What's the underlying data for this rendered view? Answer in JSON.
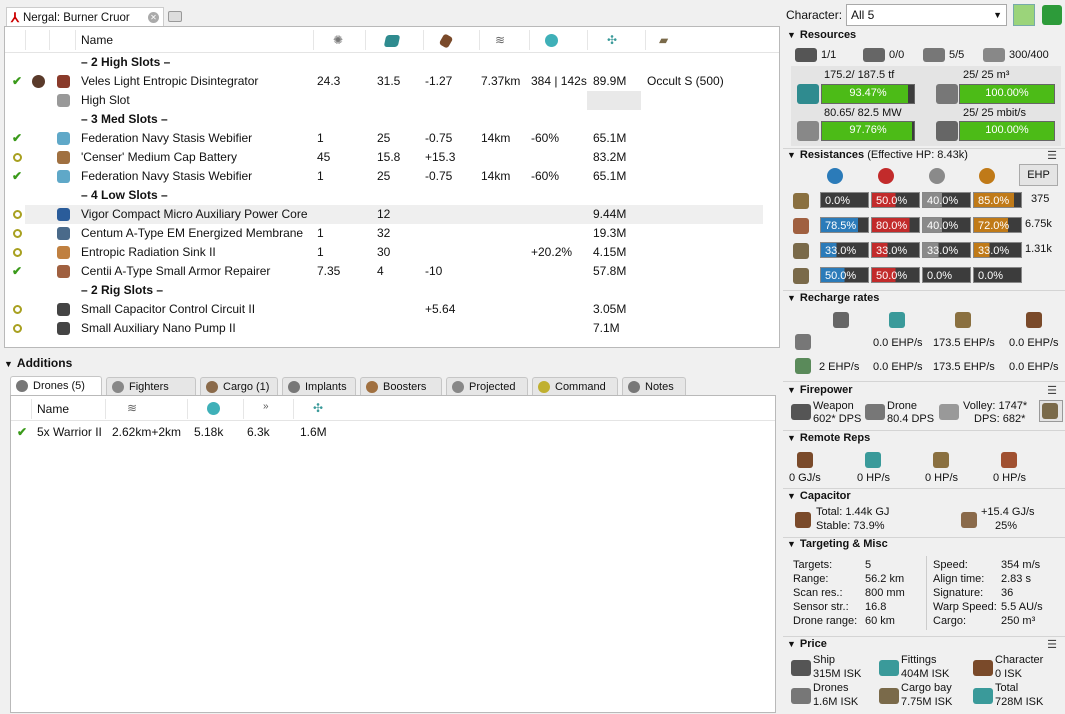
{
  "tab_title": "Nergal: Burner Cruor",
  "header": {
    "name": "Name"
  },
  "fitting_rows": [
    {
      "kind": "group",
      "name": "– 2 High Slots –"
    },
    {
      "kind": "mod",
      "state": "check",
      "mcolor": "#8a3a2a",
      "name": "Veles Light Entropic Disintegrator",
      "a": "24.3",
      "b": "31.5",
      "c": "-1.27",
      "d": "7.37km",
      "e": "384 | 142s",
      "f": "89.9M",
      "g": "Occult S (500)"
    },
    {
      "kind": "empty",
      "mcolor": "#999",
      "name": "High Slot"
    },
    {
      "kind": "group",
      "name": "– 3 Med Slots –"
    },
    {
      "kind": "mod",
      "state": "check",
      "mcolor": "#5fa8c8",
      "name": "Federation Navy Stasis Webifier",
      "a": "1",
      "b": "25",
      "c": "-0.75",
      "d": "14km",
      "e": "-60%",
      "f": "65.1M",
      "g": ""
    },
    {
      "kind": "mod",
      "state": "dot",
      "mcolor": "#a07040",
      "name": "'Censer' Medium Cap Battery",
      "a": "45",
      "b": "15.8",
      "c": "+15.3",
      "d": "",
      "e": "",
      "f": "83.2M",
      "g": ""
    },
    {
      "kind": "mod",
      "state": "check",
      "mcolor": "#5fa8c8",
      "name": "Federation Navy Stasis Webifier",
      "a": "1",
      "b": "25",
      "c": "-0.75",
      "d": "14km",
      "e": "-60%",
      "f": "65.1M",
      "g": ""
    },
    {
      "kind": "group",
      "name": "– 4 Low Slots –"
    },
    {
      "kind": "mod",
      "state": "dot",
      "mcolor": "#2a5c9a",
      "name": "Vigor Compact Micro Auxiliary Power Core",
      "a": "",
      "b": "12",
      "c": "",
      "d": "",
      "e": "",
      "f": "9.44M",
      "g": "",
      "hl": true
    },
    {
      "kind": "mod",
      "state": "dot",
      "mcolor": "#4a6a8a",
      "name": "Centum A-Type EM Energized Membrane",
      "a": "1",
      "b": "32",
      "c": "",
      "d": "",
      "e": "",
      "f": "19.3M",
      "g": ""
    },
    {
      "kind": "mod",
      "state": "dot",
      "mcolor": "#c08040",
      "name": "Entropic Radiation Sink II",
      "a": "1",
      "b": "30",
      "c": "",
      "d": "",
      "e": "+20.2%",
      "f": "4.15M",
      "g": ""
    },
    {
      "kind": "mod",
      "state": "check",
      "mcolor": "#a06040",
      "name": "Centii A-Type Small Armor Repairer",
      "a": "7.35",
      "b": "4",
      "c": "-10",
      "d": "",
      "e": "",
      "f": "57.8M",
      "g": ""
    },
    {
      "kind": "group",
      "name": "– 2 Rig Slots –"
    },
    {
      "kind": "mod",
      "state": "dot",
      "mcolor": "#444",
      "name": "Small Capacitor Control Circuit II",
      "a": "",
      "b": "",
      "c": "+5.64",
      "d": "",
      "e": "",
      "f": "3.05M",
      "g": ""
    },
    {
      "kind": "mod",
      "state": "dot",
      "mcolor": "#444",
      "name": "Small Auxiliary Nano Pump II",
      "a": "",
      "b": "",
      "c": "",
      "d": "",
      "e": "",
      "f": "7.1M",
      "g": ""
    }
  ],
  "additions": {
    "title": "Additions",
    "tabs": [
      "Drones (5)",
      "Fighters",
      "Cargo (1)",
      "Implants",
      "Boosters",
      "Projected",
      "Command",
      "Notes"
    ],
    "drone_headers": {
      "name": "Name"
    },
    "drone_row": {
      "name": "5x Warrior II",
      "range": "2.62km+2km",
      "a": "5.18k",
      "b": "6.3k",
      "price": "1.6M"
    }
  },
  "character": {
    "label": "Character:",
    "value": "All 5"
  },
  "resources": {
    "title": "Resources",
    "turrets": "1/1",
    "launchers": "0/0",
    "drones_active": "5/5",
    "drone_bay": "300/400",
    "cpu_text": "175.2/ 187.5 tf",
    "cpu_pct": "93.47%",
    "cpu_frac": 0.9347,
    "dbay_text": "25/ 25 m³",
    "dbay_pct": "100.00%",
    "dbay_frac": 1.0,
    "pg_text": "80.65/ 82.5 MW",
    "pg_pct": "97.76%",
    "pg_frac": 0.9776,
    "bw_text": "25/ 25 mbit/s",
    "bw_pct": "100.00%",
    "bw_frac": 1.0
  },
  "resistances": {
    "title": "Resistances",
    "ehp_note": "(Effective HP: 8.43k)",
    "ehp_button": "EHP",
    "rows": [
      {
        "vals": [
          "0.0%",
          "50.0%",
          "40.0%",
          "85.0%"
        ],
        "hp": "375"
      },
      {
        "vals": [
          "78.5%",
          "80.0%",
          "40.0%",
          "72.0%"
        ],
        "hp": "6.75k"
      },
      {
        "vals": [
          "33.0%",
          "33.0%",
          "33.0%",
          "33.0%"
        ],
        "hp": "1.31k"
      },
      {
        "vals": [
          "50.0%",
          "50.0%",
          "0.0%",
          "0.0%"
        ],
        "hp": ""
      }
    ]
  },
  "recharge": {
    "title": "Recharge rates",
    "row1": [
      "0.0 EHP/s",
      "173.5 EHP/s",
      "0.0 EHP/s"
    ],
    "row2": [
      "2 EHP/s",
      "0.0 EHP/s",
      "173.5 EHP/s",
      "0.0 EHP/s"
    ]
  },
  "firepower": {
    "title": "Firepower",
    "weapon_label": "Weapon",
    "weapon_dps": "602* DPS",
    "drone_label": "Drone",
    "drone_dps": "80.4 DPS",
    "volley": "Volley: 1747*",
    "dps": "DPS: 682*"
  },
  "remote_reps": {
    "title": "Remote Reps",
    "vals": [
      "0 GJ/s",
      "0 HP/s",
      "0 HP/s",
      "0 HP/s"
    ]
  },
  "capacitor": {
    "title": "Capacitor",
    "total": "Total: 1.44k GJ",
    "stable": "Stable: 73.9%",
    "delta": "+15.4 GJ/s",
    "pct": "25%"
  },
  "targeting": {
    "title": "Targeting & Misc",
    "left": [
      [
        "Targets:",
        "5"
      ],
      [
        "Range:",
        "56.2 km"
      ],
      [
        "Scan res.:",
        "800 mm"
      ],
      [
        "Sensor str.:",
        "16.8"
      ],
      [
        "Drone range:",
        "60 km"
      ]
    ],
    "right": [
      [
        "Speed:",
        "354 m/s"
      ],
      [
        "Align time:",
        "2.83 s"
      ],
      [
        "Signature:",
        "36"
      ],
      [
        "Warp Speed:",
        "5.5 AU/s"
      ],
      [
        "Cargo:",
        "250 m³"
      ]
    ]
  },
  "price": {
    "title": "Price",
    "items": [
      {
        "label": "Ship",
        "val": "315M ISK"
      },
      {
        "label": "Fittings",
        "val": "404M ISK"
      },
      {
        "label": "Character",
        "val": "0 ISK"
      },
      {
        "label": "Drones",
        "val": "1.6M ISK"
      },
      {
        "label": "Cargo bay",
        "val": "7.75M ISK"
      },
      {
        "label": "Total",
        "val": "728M ISK"
      }
    ]
  },
  "colors": {
    "em": "#2b7bb9",
    "thermal": "#c22b2b",
    "kinetic": "#8a8a8a",
    "explosive": "#c07a18",
    "fill": "#4cbb17"
  }
}
